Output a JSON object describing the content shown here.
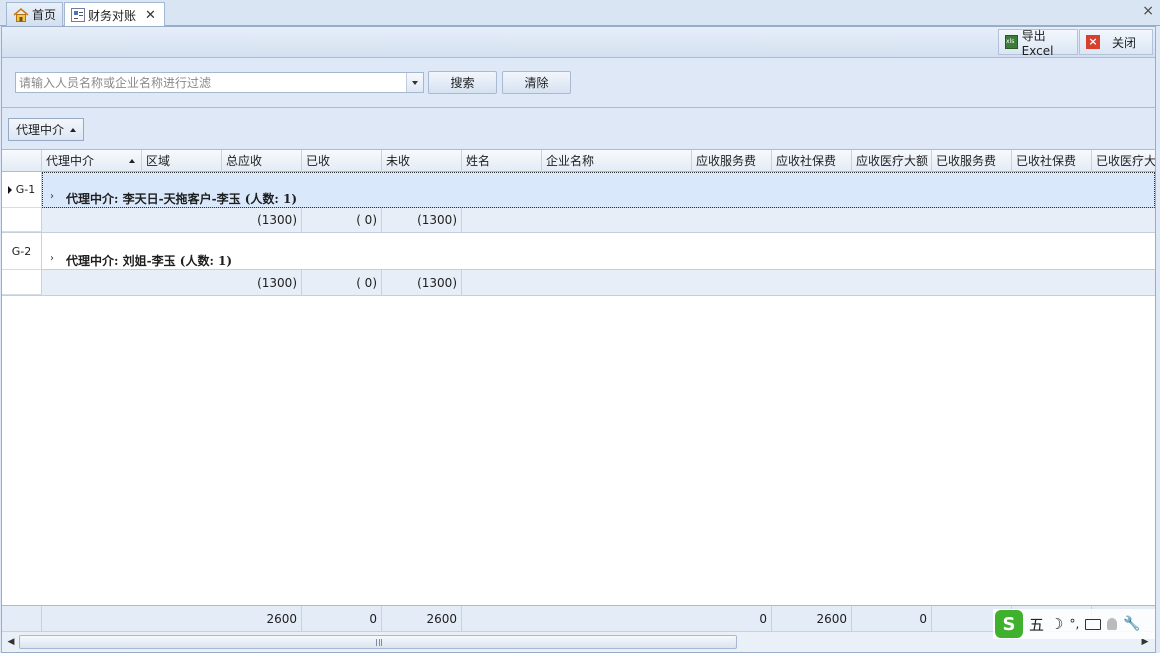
{
  "tabs": [
    {
      "label": "首页",
      "icon": "home-icon"
    },
    {
      "label": "财务对账",
      "icon": "document-icon",
      "close": "✕"
    }
  ],
  "window_close": "×",
  "toolbar": {
    "export_label": "导出Excel",
    "close_label": "关闭"
  },
  "filter": {
    "search_placeholder": "请输入人员名称或企业名称进行过滤",
    "search_value": "",
    "search_button": "搜索",
    "clear_button": "清除"
  },
  "group_by": {
    "label": "代理中介"
  },
  "columns": [
    "代理中介",
    "区域",
    "总应收",
    "已收",
    "未收",
    "姓名",
    "企业名称",
    "应收服务费",
    "应收社保费",
    "应收医疗大额",
    "已收服务费",
    "已收社保费",
    "已收医疗大"
  ],
  "groups": [
    {
      "indicator": "G-1",
      "text": "代理中介: 李天日-天拖客户-李玉 (人数: 1)",
      "selected": true,
      "summary": {
        "total": "(1300)",
        "received": "( 0)",
        "unreceived": "(1300)"
      }
    },
    {
      "indicator": "G-2",
      "text": "代理中介: 刘姐-李玉 (人数: 1)",
      "selected": false,
      "summary": {
        "total": "(1300)",
        "received": "( 0)",
        "unreceived": "(1300)"
      }
    }
  ],
  "footer": {
    "total": "2600",
    "received": "0",
    "unreceived": "2600",
    "svc_fee": "0",
    "social_fee": "2600",
    "medical_fee": "0"
  },
  "ime": {
    "mode": "五",
    "moon": "☽",
    "punct": "°,"
  },
  "colors": {
    "selected_row": "#d9e8fb",
    "panel_bg": "#dfe8f6",
    "summary_bg": "#e8eef7"
  }
}
